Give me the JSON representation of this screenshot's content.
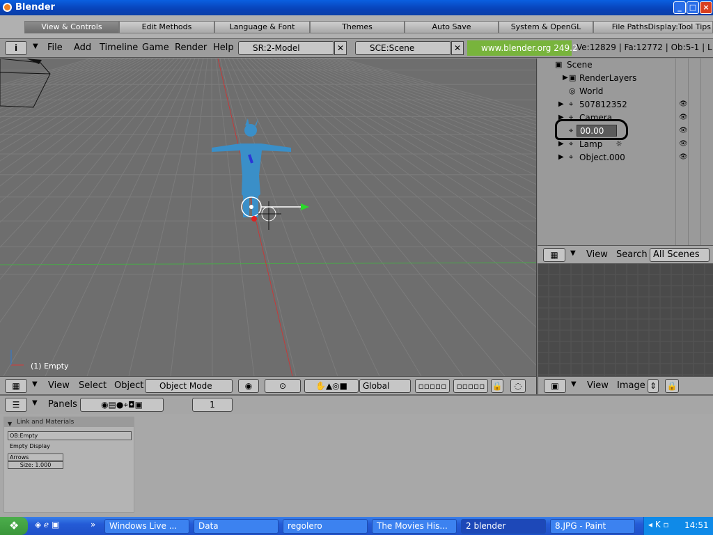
{
  "window": {
    "title": "Blender",
    "buttons": [
      "_",
      "□",
      "×"
    ]
  },
  "prefs_tabs": [
    "View & Controls",
    "Edit Methods",
    "Language & Font",
    "Themes",
    "Auto Save",
    "System & OpenGL",
    "File PathsDisplay:Tool Tips"
  ],
  "menu": {
    "info_icon": "i",
    "items": [
      "File",
      "Add",
      "Timeline",
      "Game",
      "Render",
      "Help"
    ],
    "screen": "SR:2-Model",
    "scene": "SCE:Scene",
    "blender_link": "www.blender.org 249.2",
    "stats": "Ve:12829 | Fa:12772 | Ob:5-1 | L"
  },
  "viewport": {
    "active_label": "(1) Empty",
    "axis_y": "y",
    "axis_x": "x",
    "axis_z": "z"
  },
  "viewport_header": {
    "view": "View",
    "select": "Select",
    "object": "Object",
    "mode": "Object Mode",
    "orientation": "Global"
  },
  "outliner": {
    "rows": [
      {
        "label": "Scene"
      },
      {
        "label": "RenderLayers"
      },
      {
        "label": "World"
      },
      {
        "label": "507812352"
      },
      {
        "label": "Camera"
      },
      {
        "label": "00.00"
      },
      {
        "label": "Lamp"
      },
      {
        "label": "Object.000"
      }
    ],
    "header": {
      "view": "View",
      "search": "Search",
      "scope": "All Scenes"
    }
  },
  "image_header": {
    "view": "View",
    "image": "Image"
  },
  "buttons_header": {
    "panels": "Panels",
    "frame": "1"
  },
  "panel": {
    "title": "Link and Materials",
    "ob_name": "OB:Empty",
    "empty_display": "Empty Display",
    "display_type": "Arrows",
    "size": "Size: 1.000"
  },
  "taskbar": {
    "items": [
      "Windows Live ...",
      "Data",
      "regolero",
      "The Movies His...",
      "2 blender",
      "8.JPG - Paint"
    ],
    "clock": "14:51"
  },
  "colors": {
    "accent": "#78b43c",
    "xp_blue": "#245bd6",
    "mesh": "#3a8fc8"
  }
}
